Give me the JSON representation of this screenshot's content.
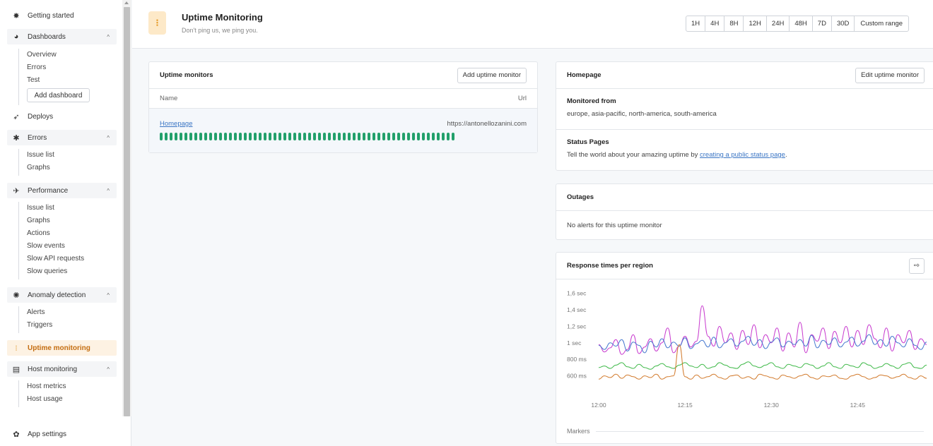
{
  "sidebar": {
    "getting_started": "Getting started",
    "dashboards": {
      "label": "Dashboards",
      "items": [
        "Overview",
        "Errors",
        "Test"
      ],
      "add_label": "Add dashboard"
    },
    "deploys": "Deploys",
    "errors": {
      "label": "Errors",
      "items": [
        "Issue list",
        "Graphs"
      ]
    },
    "performance": {
      "label": "Performance",
      "items": [
        "Issue list",
        "Graphs",
        "Actions",
        "Slow events",
        "Slow API requests",
        "Slow queries"
      ]
    },
    "anomaly": {
      "label": "Anomaly detection",
      "items": [
        "Alerts",
        "Triggers"
      ]
    },
    "uptime": "Uptime monitoring",
    "host": {
      "label": "Host monitoring",
      "items": [
        "Host metrics",
        "Host usage"
      ]
    },
    "app_settings": "App settings"
  },
  "header": {
    "title": "Uptime Monitoring",
    "subtitle": "Don't ping us, we ping you.",
    "ranges": [
      "1H",
      "4H",
      "8H",
      "12H",
      "24H",
      "48H",
      "7D",
      "30D",
      "Custom range"
    ]
  },
  "monitors_card": {
    "title": "Uptime monitors",
    "add_button": "Add uptime monitor",
    "col_name": "Name",
    "col_url": "Url",
    "row": {
      "name": "Homepage",
      "url": "https://antonellozanini.com",
      "checks_up": 60
    }
  },
  "detail_card": {
    "title": "Homepage",
    "edit_button": "Edit uptime monitor",
    "monitored_title": "Monitored from",
    "monitored_text": "europe, asia-pacific, north-america, south-america",
    "status_title": "Status Pages",
    "status_text_before": "Tell the world about your amazing uptime by ",
    "status_link": "creating a public status page",
    "status_text_after": "."
  },
  "outages_card": {
    "title": "Outages",
    "empty_text": "No alerts for this uptime monitor"
  },
  "response_card": {
    "title": "Response times per region",
    "markers_label": "Markers"
  },
  "chart_data": {
    "type": "line",
    "title": "Response times per region",
    "y_ticks": [
      "600 ms",
      "800 ms",
      "1 sec",
      "1,2 sec",
      "1,4 sec",
      "1,6 sec"
    ],
    "y_tick_values": [
      600,
      800,
      1000,
      1200,
      1400,
      1600
    ],
    "x_ticks": [
      "12:00",
      "12:15",
      "12:30",
      "12:45"
    ],
    "x_range_minutes": [
      0,
      57
    ],
    "x_tick_minutes": [
      0,
      15,
      30,
      45
    ],
    "ylim": [
      400,
      1700
    ],
    "series": [
      {
        "color": "#c83ccf",
        "values": [
          980,
          890,
          940,
          1040,
          860,
          920,
          1100,
          870,
          950,
          1050,
          900,
          1000,
          1180,
          880,
          960,
          1080,
          950,
          1020,
          1450,
          1080,
          960,
          1200,
          1000,
          1120,
          920,
          1150,
          980,
          1220,
          940,
          1100,
          1000,
          1180,
          900,
          1120,
          950,
          1250,
          880,
          1100,
          1020,
          1180,
          930,
          1140,
          1000,
          1200,
          950,
          1150,
          980,
          1220,
          1050,
          940,
          1180,
          900,
          1100,
          1000,
          1150,
          920,
          1050,
          980
        ]
      },
      {
        "color": "#4a7bd0",
        "values": [
          970,
          920,
          1000,
          960,
          1040,
          900,
          1010,
          970,
          880,
          1020,
          950,
          1050,
          940,
          1010,
          960,
          1060,
          930,
          990,
          1030,
          950,
          1070,
          940,
          1000,
          1050,
          960,
          1020,
          1080,
          970,
          1040,
          930,
          1010,
          1060,
          950,
          1020,
          980,
          1040,
          960,
          1090,
          940,
          1030,
          980,
          1060,
          950,
          1010,
          1070,
          960,
          1020,
          1100,
          980,
          1040,
          960,
          1080,
          1000,
          950,
          1050,
          970,
          920,
          1010
        ]
      },
      {
        "color": "#3cb846",
        "values": [
          700,
          720,
          690,
          730,
          760,
          710,
          690,
          740,
          700,
          680,
          720,
          750,
          710,
          690,
          730,
          760,
          720,
          700,
          740,
          690,
          710,
          760,
          730,
          700,
          690,
          740,
          770,
          720,
          700,
          730,
          760,
          710,
          690,
          740,
          720,
          700,
          750,
          730,
          690,
          720,
          760,
          710,
          690,
          740,
          720,
          700,
          760,
          730,
          690,
          710,
          750,
          720,
          690,
          740,
          760,
          700,
          690,
          730
        ]
      },
      {
        "color": "#d27a2c",
        "values": [
          560,
          600,
          580,
          620,
          570,
          610,
          590,
          560,
          600,
          580,
          620,
          560,
          590,
          600,
          980,
          590,
          560,
          610,
          570,
          590,
          620,
          580,
          560,
          600,
          610,
          570,
          590,
          560,
          620,
          600,
          580,
          560,
          610,
          590,
          570,
          600,
          620,
          580,
          560,
          600,
          590,
          610,
          570,
          560,
          600,
          620,
          590,
          560,
          580,
          610,
          600,
          570,
          590,
          620,
          580,
          560,
          600,
          570
        ]
      }
    ]
  }
}
